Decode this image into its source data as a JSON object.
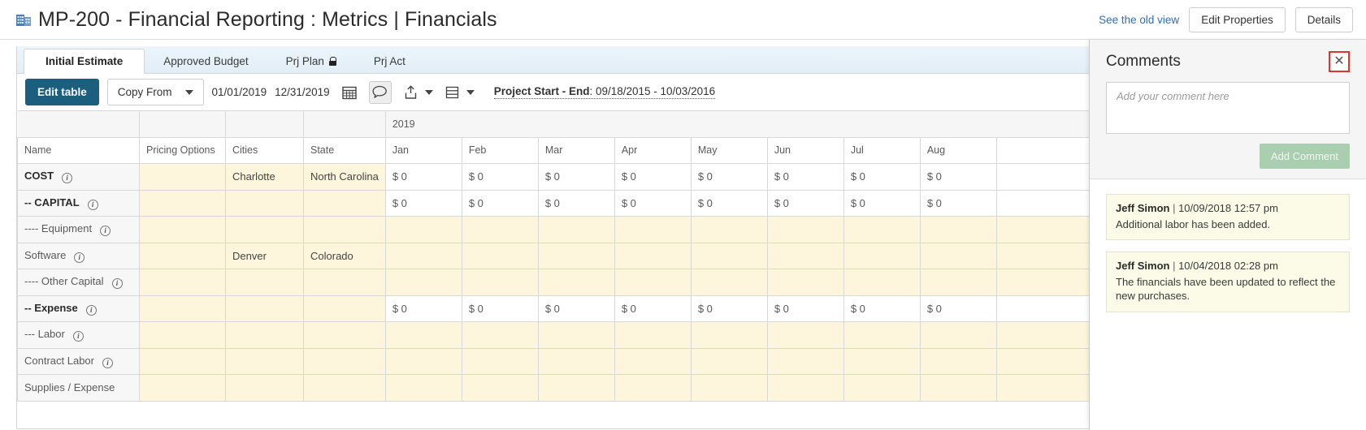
{
  "header": {
    "icon": "building-icon",
    "title": "MP-200 - Financial Reporting : Metrics | Financials",
    "old_view_link": "See the old view",
    "edit_properties_label": "Edit Properties",
    "details_label": "Details"
  },
  "tabs": [
    {
      "label": "Initial Estimate",
      "active": true,
      "locked": false
    },
    {
      "label": "Approved Budget",
      "active": false,
      "locked": false
    },
    {
      "label": "Prj Plan",
      "active": false,
      "locked": true
    },
    {
      "label": "Prj Act",
      "active": false,
      "locked": false
    }
  ],
  "toolbar": {
    "edit_table_label": "Edit table",
    "copy_from_label": "Copy From",
    "start_date": "01/01/2019",
    "end_date": "12/31/2019",
    "calendar_icon": "calendar-icon",
    "comment_icon": "comment-icon",
    "export_icon": "export-icon",
    "rows_icon": "rows-icon",
    "project_dates_label": "Project Start - End",
    "project_dates_value": ": 09/18/2015 - 10/03/2016"
  },
  "table": {
    "year_group": "2019",
    "columns": [
      "Name",
      "Pricing Options",
      "Cities",
      "State"
    ],
    "months": [
      "Jan",
      "Feb",
      "Mar",
      "Apr",
      "May",
      "Jun",
      "Jul",
      "Aug"
    ],
    "zero_value": "$ 0",
    "rows": [
      {
        "name": "COST",
        "bold": true,
        "info": true,
        "pricing": "",
        "city": "Charlotte",
        "state": "North Carolina",
        "has_values": true
      },
      {
        "name": "-- CAPITAL",
        "bold": true,
        "info": true,
        "pricing": "",
        "city": "",
        "state": "",
        "has_values": true
      },
      {
        "name": "---- Equipment",
        "bold": false,
        "info": true,
        "pricing": "",
        "city": "",
        "state": "",
        "has_values": false
      },
      {
        "name": "Software",
        "bold": false,
        "info": true,
        "pricing": "",
        "city": "Denver",
        "state": "Colorado",
        "has_values": false
      },
      {
        "name": "---- Other Capital",
        "bold": false,
        "info": true,
        "pricing": "",
        "city": "",
        "state": "",
        "has_values": false
      },
      {
        "name": "-- Expense",
        "bold": true,
        "info": true,
        "pricing": "",
        "city": "",
        "state": "",
        "has_values": true
      },
      {
        "name": "--- Labor",
        "bold": false,
        "info": true,
        "pricing": "",
        "city": "",
        "state": "",
        "has_values": false
      },
      {
        "name": "Contract Labor",
        "bold": false,
        "info": true,
        "pricing": "",
        "city": "",
        "state": "",
        "has_values": false
      },
      {
        "name": "Supplies / Expense",
        "bold": false,
        "info": false,
        "pricing": "",
        "city": "",
        "state": "",
        "has_values": false
      }
    ]
  },
  "comments": {
    "title": "Comments",
    "close_icon": "close-icon",
    "input_placeholder": "Add your comment here",
    "input_value": "",
    "add_button_label": "Add Comment",
    "items": [
      {
        "author": "Jeff Simon",
        "separator": "|",
        "date": "10/09/2018 12:57 pm",
        "text": "Additional labor has been added."
      },
      {
        "author": "Jeff Simon",
        "separator": "|",
        "date": "10/04/2018 02:28 pm",
        "text": "The financials have been updated to reflect the new purchases."
      }
    ]
  },
  "colors": {
    "primary_button": "#1b5e7e",
    "link": "#2f6fb5",
    "attribute_cell": "#fdf6dc",
    "comment_bg": "#fbfbe8",
    "close_highlight": "#e2352a",
    "add_button": "#a9cfb0"
  }
}
